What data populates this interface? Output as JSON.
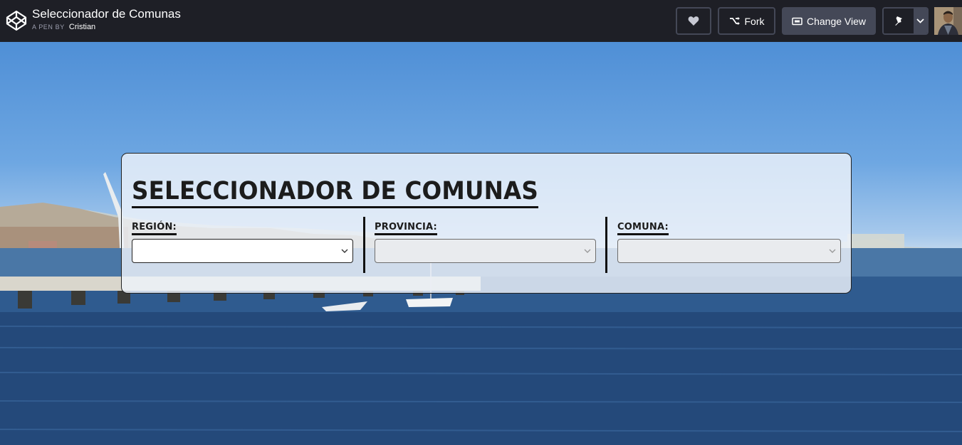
{
  "header": {
    "pen_title": "Seleccionador de Comunas",
    "pen_by_label": "A PEN BY",
    "author": "Cristian",
    "fork_label": "Fork",
    "change_view_label": "Change View"
  },
  "card": {
    "title": "SELECCIONADOR DE COMUNAS",
    "fields": [
      {
        "label": "REGIÓN:",
        "value": "",
        "disabled": false
      },
      {
        "label": "PROVINCIA:",
        "value": "",
        "disabled": true
      },
      {
        "label": "COMUNA:",
        "value": "",
        "disabled": true
      }
    ]
  },
  "icons": [
    "codepen-logo-icon",
    "heart-icon",
    "fork-icon",
    "change-view-icon",
    "pin-icon",
    "chevron-down-icon"
  ],
  "colors": {
    "topbar": "#1e1f26",
    "button_solid": "#444857",
    "button_border": "#444857"
  }
}
